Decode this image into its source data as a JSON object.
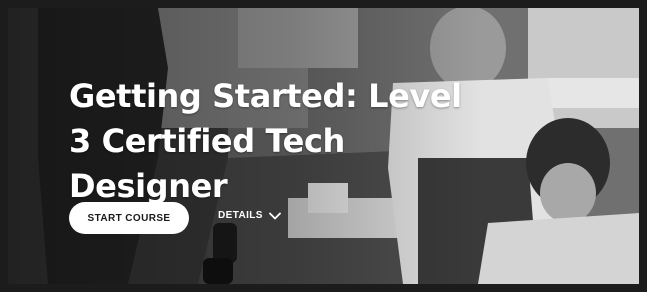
{
  "course": {
    "title": "Getting Started: Level 3 Certified Tech Designer",
    "start_label": "START COURSE",
    "details_label": "DETAILS"
  },
  "icons": {
    "details_toggle": "chevron-down-icon"
  },
  "colors": {
    "frame": "#1c1c1c",
    "button_bg": "#ffffff",
    "button_text": "#1a1a1a",
    "title_text": "#ffffff"
  }
}
